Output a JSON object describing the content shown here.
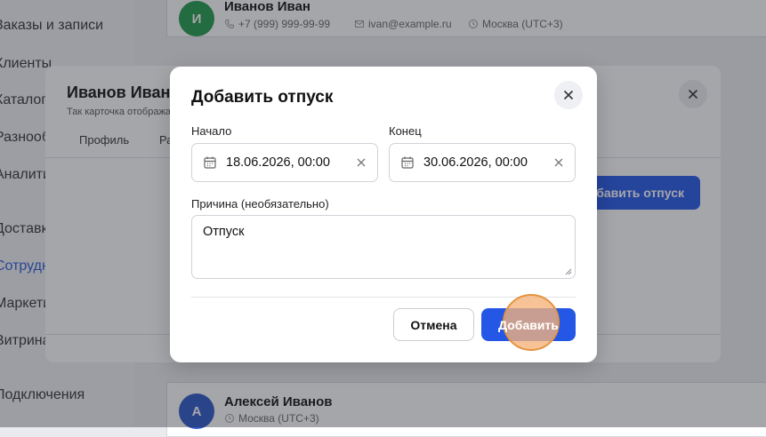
{
  "sidebar": {
    "items": [
      {
        "label": "Заказы и записи"
      },
      {
        "label": "Клиенты"
      },
      {
        "label": "Каталог"
      },
      {
        "label": "Разнообразие"
      },
      {
        "label": "Аналитика"
      },
      {
        "label": "Доставка"
      },
      {
        "label": "Сотрудники и смены"
      },
      {
        "label": "Маркетинг"
      },
      {
        "label": "Витрина"
      },
      {
        "label": "Подключения"
      }
    ]
  },
  "list": {
    "person1": {
      "initial": "И",
      "name": "Иванов Иван",
      "phone": "+7 (999) 999-99-99",
      "email": "ivan@example.ru",
      "timezone": "Москва (UTC+3)",
      "avatar_color": "#1f9a4a"
    },
    "person2": {
      "initial": "А",
      "name": "Алексей Иванов",
      "timezone": "Москва (UTC+3)",
      "avatar_color": "#2b57c9"
    }
  },
  "employee_modal": {
    "title": "Иванов Иван",
    "subtitle": "Так карточка отображается",
    "tabs": [
      "Профиль",
      "Расписание"
    ],
    "add_vacation_button": "Добавить отпуск"
  },
  "vacation_dialog": {
    "title": "Добавить отпуск",
    "start": {
      "label": "Начало",
      "value": "18.06.2026, 00:00"
    },
    "end": {
      "label": "Конец",
      "value": "30.06.2026, 00:00"
    },
    "reason": {
      "label": "Причина (необязательно)",
      "value": "Отпуск"
    },
    "cancel_label": "Отмена",
    "add_label": "Добавить"
  },
  "colors": {
    "accent": "#2457e6",
    "click_indicator": "#f5b278"
  }
}
